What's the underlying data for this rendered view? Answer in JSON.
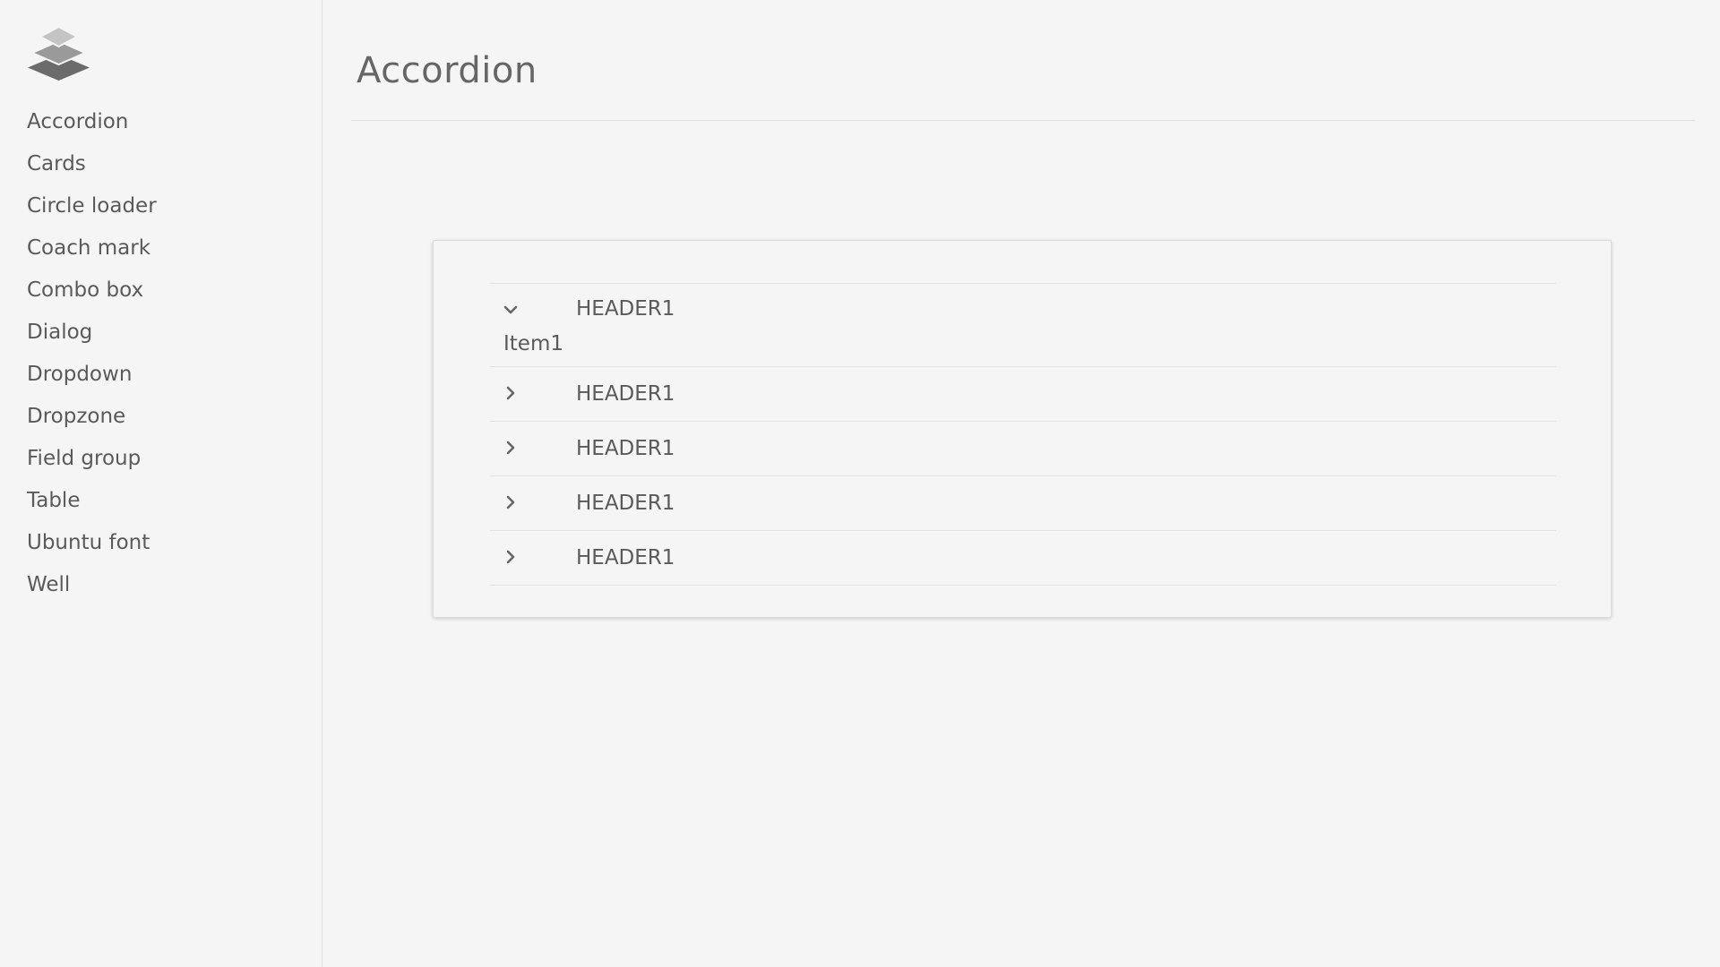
{
  "sidebar": {
    "logo_icon": "layers-icon",
    "items": [
      {
        "label": "Accordion"
      },
      {
        "label": "Cards"
      },
      {
        "label": "Circle loader"
      },
      {
        "label": "Coach mark"
      },
      {
        "label": "Combo box"
      },
      {
        "label": "Dialog"
      },
      {
        "label": "Dropdown"
      },
      {
        "label": "Dropzone"
      },
      {
        "label": "Field group"
      },
      {
        "label": "Table"
      },
      {
        "label": "Ubuntu font"
      },
      {
        "label": "Well"
      }
    ]
  },
  "main": {
    "title": "Accordion",
    "accordion": {
      "sections": [
        {
          "header": "HEADER1",
          "expanded": true,
          "icon": "chevron-down-icon",
          "body": "Item1"
        },
        {
          "header": "HEADER1",
          "expanded": false,
          "icon": "chevron-right-icon"
        },
        {
          "header": "HEADER1",
          "expanded": false,
          "icon": "chevron-right-icon"
        },
        {
          "header": "HEADER1",
          "expanded": false,
          "icon": "chevron-right-icon"
        },
        {
          "header": "HEADER1",
          "expanded": false,
          "icon": "chevron-right-icon"
        }
      ]
    }
  },
  "colors": {
    "background": "#f5f5f5",
    "text": "#5a5a5a",
    "divider": "#e3e3e3"
  }
}
